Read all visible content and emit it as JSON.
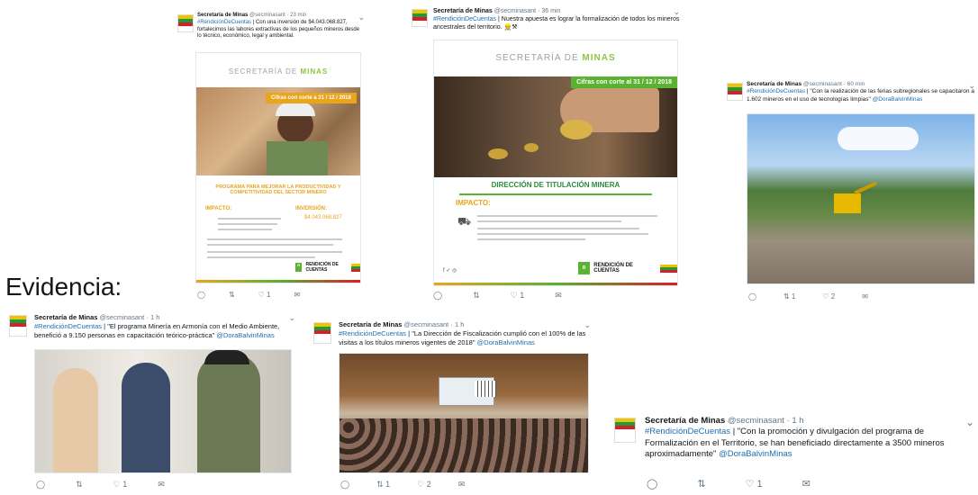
{
  "caption": "Evidencia:",
  "tweets": [
    {
      "name": "Secretaría de Minas",
      "handle": "@secminasant",
      "time": "· 23 min",
      "hashtag": "#RendiciónDeCuentas",
      "text": "| Con una inversión de $4.043.068.827, fortalecimos las labores extractivas de los pequeños mineros desde lo técnico, económico, legal y ambiental.",
      "poster": {
        "title_a": "SECRETARÍA DE",
        "title_b": "MINAS",
        "ribbon": "Cifras con corte a 31 / 12 / 2018",
        "program": "PROGRAMA PARA MEJORAR LA PRODUCTIVIDAD Y COMPETITIVIDAD DEL SECTOR MINERO",
        "impact": "IMPACTO:",
        "investment": "INVERSIÓN:",
        "amount": "$4.043.068.827",
        "logo": "RENDICIÓN DE CUENTAS"
      },
      "actions": {
        "reply": "",
        "retweet": "",
        "like": "1",
        "dm": ""
      }
    },
    {
      "name": "Secretaría de Minas",
      "handle": "@secminasant",
      "time": "· 36 min",
      "hashtag": "#RendiciónDeCuentas",
      "text": "| Nuestra apuesta es lograr la formalización de todos los mineros ancestrales del territorio. 👷⚒",
      "poster": {
        "title_a": "SECRETARÍA DE",
        "title_b": "MINAS",
        "ribbon": "Cifras con corte al 31 / 12 / 2018",
        "program": "DIRECCIÓN DE TITULACIÓN MINERA",
        "impact": "IMPACTO:",
        "logo": "RENDICIÓN DE CUENTAS"
      },
      "actions": {
        "reply": "",
        "retweet": "",
        "like": "1",
        "dm": ""
      }
    },
    {
      "name": "Secretaría de Minas",
      "handle": "@secminasant",
      "time": "· 60 min",
      "hashtag": "#RendiciónDeCuentas",
      "text": "| \"Con la realización de las ferias subregionales se capacitaron a 1.602 mineros en el uso de tecnologías limpias\"",
      "mention": "@DoraBalvinMinas",
      "actions": {
        "reply": "",
        "retweet": "1",
        "like": "2",
        "dm": ""
      }
    },
    {
      "name": "Secretaría de Minas",
      "handle": "@secminasant",
      "time": "· 1 h",
      "hashtag": "#RendiciónDeCuentas",
      "text": "| \"El programa Minería en Armonía con el Medio Ambiente, benefició a  9.150 personas  en capacitación teórico-práctica\"",
      "mention": "@DoraBalvinMinas",
      "actions": {
        "reply": "",
        "retweet": "",
        "like": "1",
        "dm": ""
      }
    },
    {
      "name": "Secretaría de Minas",
      "handle": "@secminasant",
      "time": "· 1 h",
      "hashtag": "#RendiciónDeCuentas",
      "text": "| \"La Dirección de Fiscalización cumplió con el 100% de las visitas a los títulos mineros vigentes de  2018\"",
      "mention": "@DoraBalvinMinas",
      "actions": {
        "reply": "",
        "retweet": "1",
        "like": "2",
        "dm": ""
      }
    },
    {
      "name": "Secretaría de Minas",
      "handle": "@secminasant",
      "time": "· 1 h",
      "hashtag": "#RendiciónDeCuentas",
      "text": "| \"Con la promoción y divulgación del programa de Formalización en el Territorio, se han beneficiado directamente a 3500 mineros aproximadamente\"",
      "mention": "@DoraBalvinMinas",
      "actions": {
        "reply": "",
        "retweet": "",
        "like": "1",
        "dm": ""
      }
    }
  ],
  "icons": {
    "reply": "reply-icon",
    "retweet": "retweet-icon",
    "like": "heart-icon",
    "dm": "envelope-icon",
    "menu": "chevron-down-icon"
  },
  "colors": {
    "link": "#1b6fb3",
    "orange": "#e9a51c",
    "green": "#5bb130",
    "muted": "#657786"
  }
}
